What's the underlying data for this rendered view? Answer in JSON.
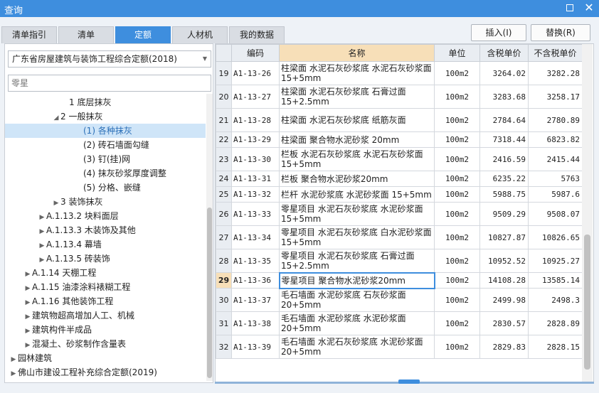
{
  "window": {
    "title": "查询",
    "maximize_glyph": "",
    "close_glyph": "✕"
  },
  "tabs": [
    {
      "label": "清单指引"
    },
    {
      "label": "清单"
    },
    {
      "label": "定额"
    },
    {
      "label": "人材机"
    },
    {
      "label": "我的数据"
    }
  ],
  "toolbar": {
    "insert_label": "插入(I)",
    "replace_label": "替换(R)"
  },
  "left": {
    "dropdown_value": "广东省房屋建筑与装饰工程综合定额(2018)",
    "search_value": "零星",
    "tree": [
      {
        "label": "1 底层抹灰",
        "expander": ""
      },
      {
        "label": "2 一般抹灰",
        "expander": "◢"
      },
      {
        "label": "(1) 各种抹灰",
        "expander": ""
      },
      {
        "label": "(2) 砖石墙面勾缝",
        "expander": ""
      },
      {
        "label": "(3) 钉(挂)网",
        "expander": ""
      },
      {
        "label": "(4) 抹灰砂浆厚度调整",
        "expander": ""
      },
      {
        "label": "(5) 分格、嵌缝",
        "expander": ""
      },
      {
        "label": "3 装饰抹灰",
        "expander": "▶"
      },
      {
        "label": "A.1.13.2 块料面层",
        "expander": "▶"
      },
      {
        "label": "A.1.13.3 木装饰及其他",
        "expander": "▶"
      },
      {
        "label": "A.1.13.4 幕墙",
        "expander": "▶"
      },
      {
        "label": "A.1.13.5 砖装饰",
        "expander": "▶"
      },
      {
        "label": "A.1.14 天棚工程",
        "expander": "▶"
      },
      {
        "label": "A.1.15 油漆涂料裱糊工程",
        "expander": "▶"
      },
      {
        "label": "A.1.16 其他装饰工程",
        "expander": "▶"
      },
      {
        "label": "建筑物超高增加人工、机械",
        "expander": "▶"
      },
      {
        "label": "建筑构件半成品",
        "expander": "▶"
      },
      {
        "label": "混凝土、砂浆制作含量表",
        "expander": "▶"
      },
      {
        "label": "园林建筑",
        "expander": "▶"
      },
      {
        "label": "佛山市建设工程补充综合定额(2019)",
        "expander": "▶"
      }
    ]
  },
  "table": {
    "headers": {
      "code": "编码",
      "name": "名称",
      "unit": "单位",
      "price_tax": "含税单价",
      "price_notax": "不含税单价"
    },
    "rows": [
      {
        "n": "19",
        "code": "A1-13-26",
        "name": "柱梁面 水泥石灰砂浆底 水泥石灰砂浆面 15+5mm",
        "unit": "100m2",
        "p1": "3264.02",
        "p2": "3282.28"
      },
      {
        "n": "20",
        "code": "A1-13-27",
        "name": "柱梁面 水泥石灰砂浆底 石膏过面 15+2.5mm",
        "unit": "100m2",
        "p1": "3283.68",
        "p2": "3258.17"
      },
      {
        "n": "21",
        "code": "A1-13-28",
        "name": "柱梁面 水泥石灰砂浆底 纸筋灰面",
        "unit": "100m2",
        "p1": "2784.64",
        "p2": "2780.89"
      },
      {
        "n": "22",
        "code": "A1-13-29",
        "name": "柱梁面 聚合物水泥砂浆 20mm",
        "unit": "100m2",
        "p1": "7318.44",
        "p2": "6823.82"
      },
      {
        "n": "23",
        "code": "A1-13-30",
        "name": "栏板 水泥石灰砂浆底 水泥石灰砂浆面 15+5mm",
        "unit": "100m2",
        "p1": "2416.59",
        "p2": "2415.44"
      },
      {
        "n": "24",
        "code": "A1-13-31",
        "name": "栏板 聚合物水泥砂浆20mm",
        "unit": "100m2",
        "p1": "6235.22",
        "p2": "5763"
      },
      {
        "n": "25",
        "code": "A1-13-32",
        "name": "栏杆 水泥砂浆底 水泥砂浆面 15+5mm",
        "unit": "100m2",
        "p1": "5988.75",
        "p2": "5987.6"
      },
      {
        "n": "26",
        "code": "A1-13-33",
        "name": "零星项目 水泥石灰砂浆底 水泥砂浆面 15+5mm",
        "unit": "100m2",
        "p1": "9509.29",
        "p2": "9508.07"
      },
      {
        "n": "27",
        "code": "A1-13-34",
        "name": "零星项目 水泥石灰砂浆底 白水泥砂浆面 15+5mm",
        "unit": "100m2",
        "p1": "10827.87",
        "p2": "10826.65"
      },
      {
        "n": "28",
        "code": "A1-13-35",
        "name": "零星项目 水泥石灰砂浆底 石膏过面 15+2.5mm",
        "unit": "100m2",
        "p1": "10952.52",
        "p2": "10925.27"
      },
      {
        "n": "29",
        "code": "A1-13-36",
        "name": "零星项目 聚合物水泥砂浆20mm",
        "unit": "100m2",
        "p1": "14108.28",
        "p2": "13585.14"
      },
      {
        "n": "30",
        "code": "A1-13-37",
        "name": "毛石墙面 水泥砂浆底 石灰砂浆面 20+5mm",
        "unit": "100m2",
        "p1": "2499.98",
        "p2": "2498.3"
      },
      {
        "n": "31",
        "code": "A1-13-38",
        "name": "毛石墙面 水泥砂浆底 水泥砂浆面 20+5mm",
        "unit": "100m2",
        "p1": "2830.57",
        "p2": "2828.89"
      },
      {
        "n": "32",
        "code": "A1-13-39",
        "name": "毛石墙面 水泥石灰砂浆底 水泥砂浆面 20+5mm",
        "unit": "100m2",
        "p1": "2829.83",
        "p2": "2828.15"
      }
    ]
  }
}
